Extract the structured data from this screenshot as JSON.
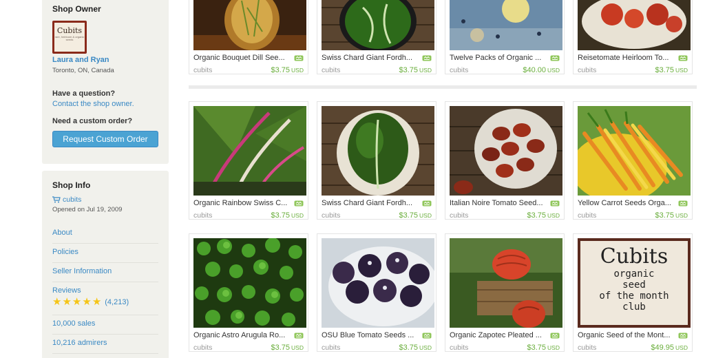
{
  "sidebar": {
    "owner_heading": "Shop Owner",
    "logo_text": "Cubits",
    "logo_subtext": "rare, heirloom & organic seeds",
    "owner_name": "Laura and Ryan",
    "owner_location": "Toronto, ON, Canada",
    "question_label": "Have a question?",
    "contact_link": "Contact the shop owner.",
    "custom_label": "Need a custom order?",
    "custom_button": "Request Custom Order",
    "info_heading": "Shop Info",
    "shop_name": "cubits",
    "opened": "Opened on Jul 19, 2009",
    "links": {
      "about": "About",
      "policies": "Policies",
      "seller": "Seller Information",
      "reviews": "Reviews",
      "review_count": "(4,213)",
      "sales": "10,000 sales",
      "admirers": "10,216 admirers"
    },
    "rating_stars": 5
  },
  "listings": [
    {
      "title": "Organic Bouquet Dill See...",
      "shop": "cubits",
      "price": "$3.75",
      "currency": "USD"
    },
    {
      "title": "Swiss Chard Giant Fordh...",
      "shop": "cubits",
      "price": "$3.75",
      "currency": "USD"
    },
    {
      "title": "Twelve Packs of Organic ...",
      "shop": "cubits",
      "price": "$40.00",
      "currency": "USD"
    },
    {
      "title": "Reisetomate Heirloom To...",
      "shop": "cubits",
      "price": "$3.75",
      "currency": "USD"
    },
    {
      "title": "Organic Rainbow Swiss C...",
      "shop": "cubits",
      "price": "$3.75",
      "currency": "USD"
    },
    {
      "title": "Swiss Chard Giant Fordh...",
      "shop": "cubits",
      "price": "$3.75",
      "currency": "USD"
    },
    {
      "title": "Italian Noire Tomato Seed...",
      "shop": "cubits",
      "price": "$3.75",
      "currency": "USD"
    },
    {
      "title": "Yellow Carrot Seeds Orga...",
      "shop": "cubits",
      "price": "$3.75",
      "currency": "USD"
    },
    {
      "title": "Organic Astro Arugula Ro...",
      "shop": "cubits",
      "price": "$3.75",
      "currency": "USD"
    },
    {
      "title": "OSU Blue Tomato Seeds ...",
      "shop": "cubits",
      "price": "$3.75",
      "currency": "USD"
    },
    {
      "title": "Organic Zapotec Pleated ...",
      "shop": "cubits",
      "price": "$3.75",
      "currency": "USD"
    },
    {
      "title": "Organic Seed of the Mont...",
      "shop": "cubits",
      "price": "$49.95",
      "currency": "USD"
    }
  ],
  "club_card": {
    "brand": "Cubits",
    "line1": "organic",
    "line2": "seed",
    "line3": "of the month",
    "line4": "club"
  },
  "colors": {
    "link": "#3a89c4",
    "price": "#6aae3c",
    "button": "#4ba3d3",
    "sidebar_bg": "#f1f1ec"
  }
}
